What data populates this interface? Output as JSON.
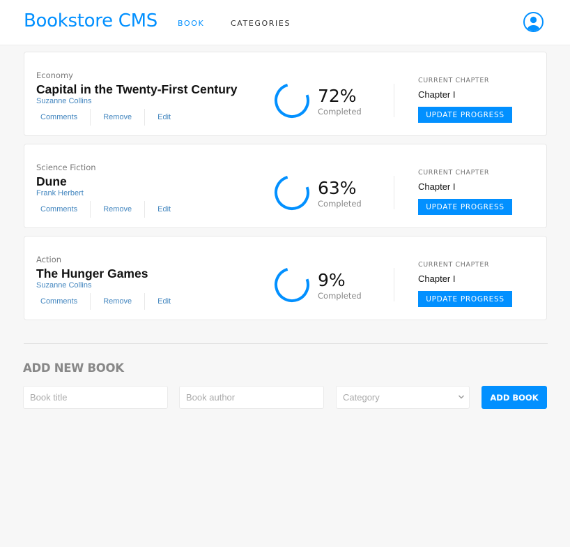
{
  "header": {
    "brand": "Bookstore CMS",
    "nav": [
      {
        "label": "BOOK"
      },
      {
        "label": "CATEGORIES"
      }
    ]
  },
  "books": [
    {
      "category": "Economy",
      "title": "Capital in the Twenty-First Century",
      "author": "Suzanne Collins",
      "actions": [
        "Comments",
        "Remove",
        "Edit"
      ],
      "progress": 72,
      "progress_text": "72%",
      "completed_label": "Completed",
      "chapter_label": "CURRENT CHAPTER",
      "chapter": "Chapter I",
      "update_label": "UPDATE PROGRESS"
    },
    {
      "category": "Science Fiction",
      "title": "Dune",
      "author": "Frank Herbert",
      "actions": [
        "Comments",
        "Remove",
        "Edit"
      ],
      "progress": 63,
      "progress_text": "63%",
      "completed_label": "Completed",
      "chapter_label": "CURRENT CHAPTER",
      "chapter": "Chapter I",
      "update_label": "UPDATE PROGRESS"
    },
    {
      "category": "Action",
      "title": "The Hunger Games",
      "author": "Suzanne Collins",
      "actions": [
        "Comments",
        "Remove",
        "Edit"
      ],
      "progress": 9,
      "progress_text": "9%",
      "completed_label": "Completed",
      "chapter_label": "CURRENT CHAPTER",
      "chapter": "Chapter I",
      "update_label": "UPDATE PROGRESS"
    }
  ],
  "add_form": {
    "heading": "ADD NEW BOOK",
    "title_placeholder": "Book title",
    "author_placeholder": "Book author",
    "category_placeholder": "Category",
    "submit_label": "ADD BOOK"
  },
  "colors": {
    "accent": "#0290ff",
    "link": "#4386bf"
  }
}
